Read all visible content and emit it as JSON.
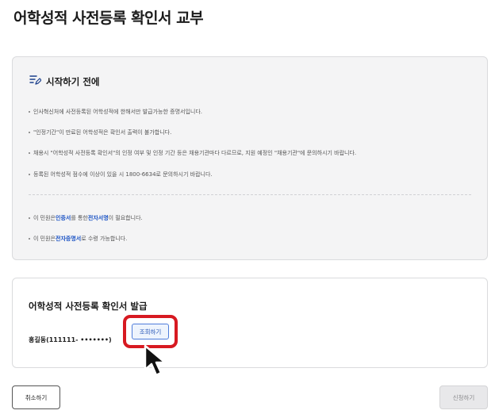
{
  "page": {
    "title": "어학성적 사전등록 확인서 교부"
  },
  "intro": {
    "title": "시작하기 전에",
    "icon": "checklist-edit-icon",
    "notes": [
      "인사혁신처에 사전등록된 어학성적에 한해서만 발급가능한 증명서입니다.",
      "\"인정기간\"이 만료된 어학성적은 확인서 출력이 불가합니다.",
      "채용시 \"어학성적 사전등록 확인서\"의 인정 여부 및 인정 기간 등은 채용기관마다 다르므로, 지원 예정인 \"채용기관\"에 문의하시기 바랍니다.",
      "등록된 어학성적 점수에 이상이 있을 시 1800-6634로 문의하시기 바랍니다."
    ],
    "note5": {
      "pre": "이 민원은 ",
      "hl1": "인증서",
      "mid": "를 통한 ",
      "hl2": "전자서명",
      "post": "이 필요합니다."
    },
    "note6": {
      "pre": "이 민원은 ",
      "hl1": "전자증명서",
      "post": "로 수령 가능합니다."
    }
  },
  "issue": {
    "title": "어학성적 사전등록 확인서 발급",
    "person": "홍길동(111111- •••••••)",
    "lookup_label": "조회하기"
  },
  "footer": {
    "cancel_label": "취소하기",
    "apply_label": "신청하기"
  },
  "colors": {
    "highlight": "#d71921",
    "link": "#1a52c4",
    "disabled": "#e8e8ea"
  }
}
